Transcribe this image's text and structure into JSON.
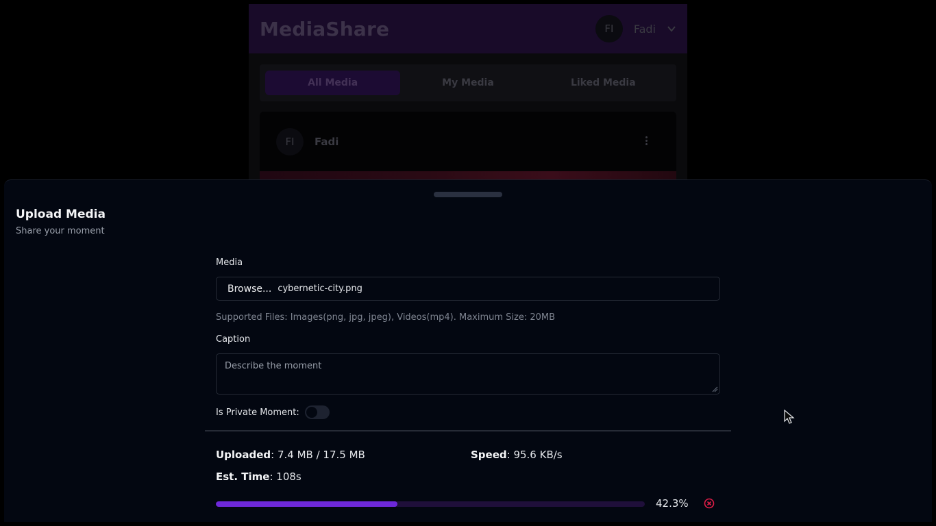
{
  "app": {
    "brand": "MediaShare",
    "user": {
      "initials": "FI",
      "name": "Fadi"
    },
    "tabs": [
      {
        "label": "All Media",
        "active": true
      },
      {
        "label": "My Media",
        "active": false
      },
      {
        "label": "Liked Media",
        "active": false
      }
    ],
    "post": {
      "initials": "FI",
      "user": "Fadi"
    }
  },
  "sheet": {
    "title": "Upload Media",
    "subtitle": "Share your moment",
    "media_label": "Media",
    "browse_label": "Browse...",
    "file_name": "cybernetic-city.png",
    "help_text": "Supported Files: Images(png, jpg, jpeg), Videos(mp4). Maximum Size: 20MB",
    "caption_label": "Caption",
    "caption_placeholder": "Describe the moment",
    "private_label": "Is Private Moment:",
    "private_on": false
  },
  "upload": {
    "uploaded_label": "Uploaded",
    "uploaded_value": ": 7.4 MB / 17.5 MB",
    "speed_label": "Speed",
    "speed_value": ": 95.6 KB/s",
    "est_label": "Est. Time",
    "est_value": ": 108s",
    "progress_percent": 42.3,
    "progress_text": "42.3%"
  },
  "colors": {
    "accent": "#6d28d9",
    "sheet_bg": "#030711",
    "cancel": "#e11d48"
  },
  "icons": [
    "chevron-down-icon",
    "more-vertical-icon",
    "cancel-circle-icon",
    "mouse-cursor-icon"
  ]
}
